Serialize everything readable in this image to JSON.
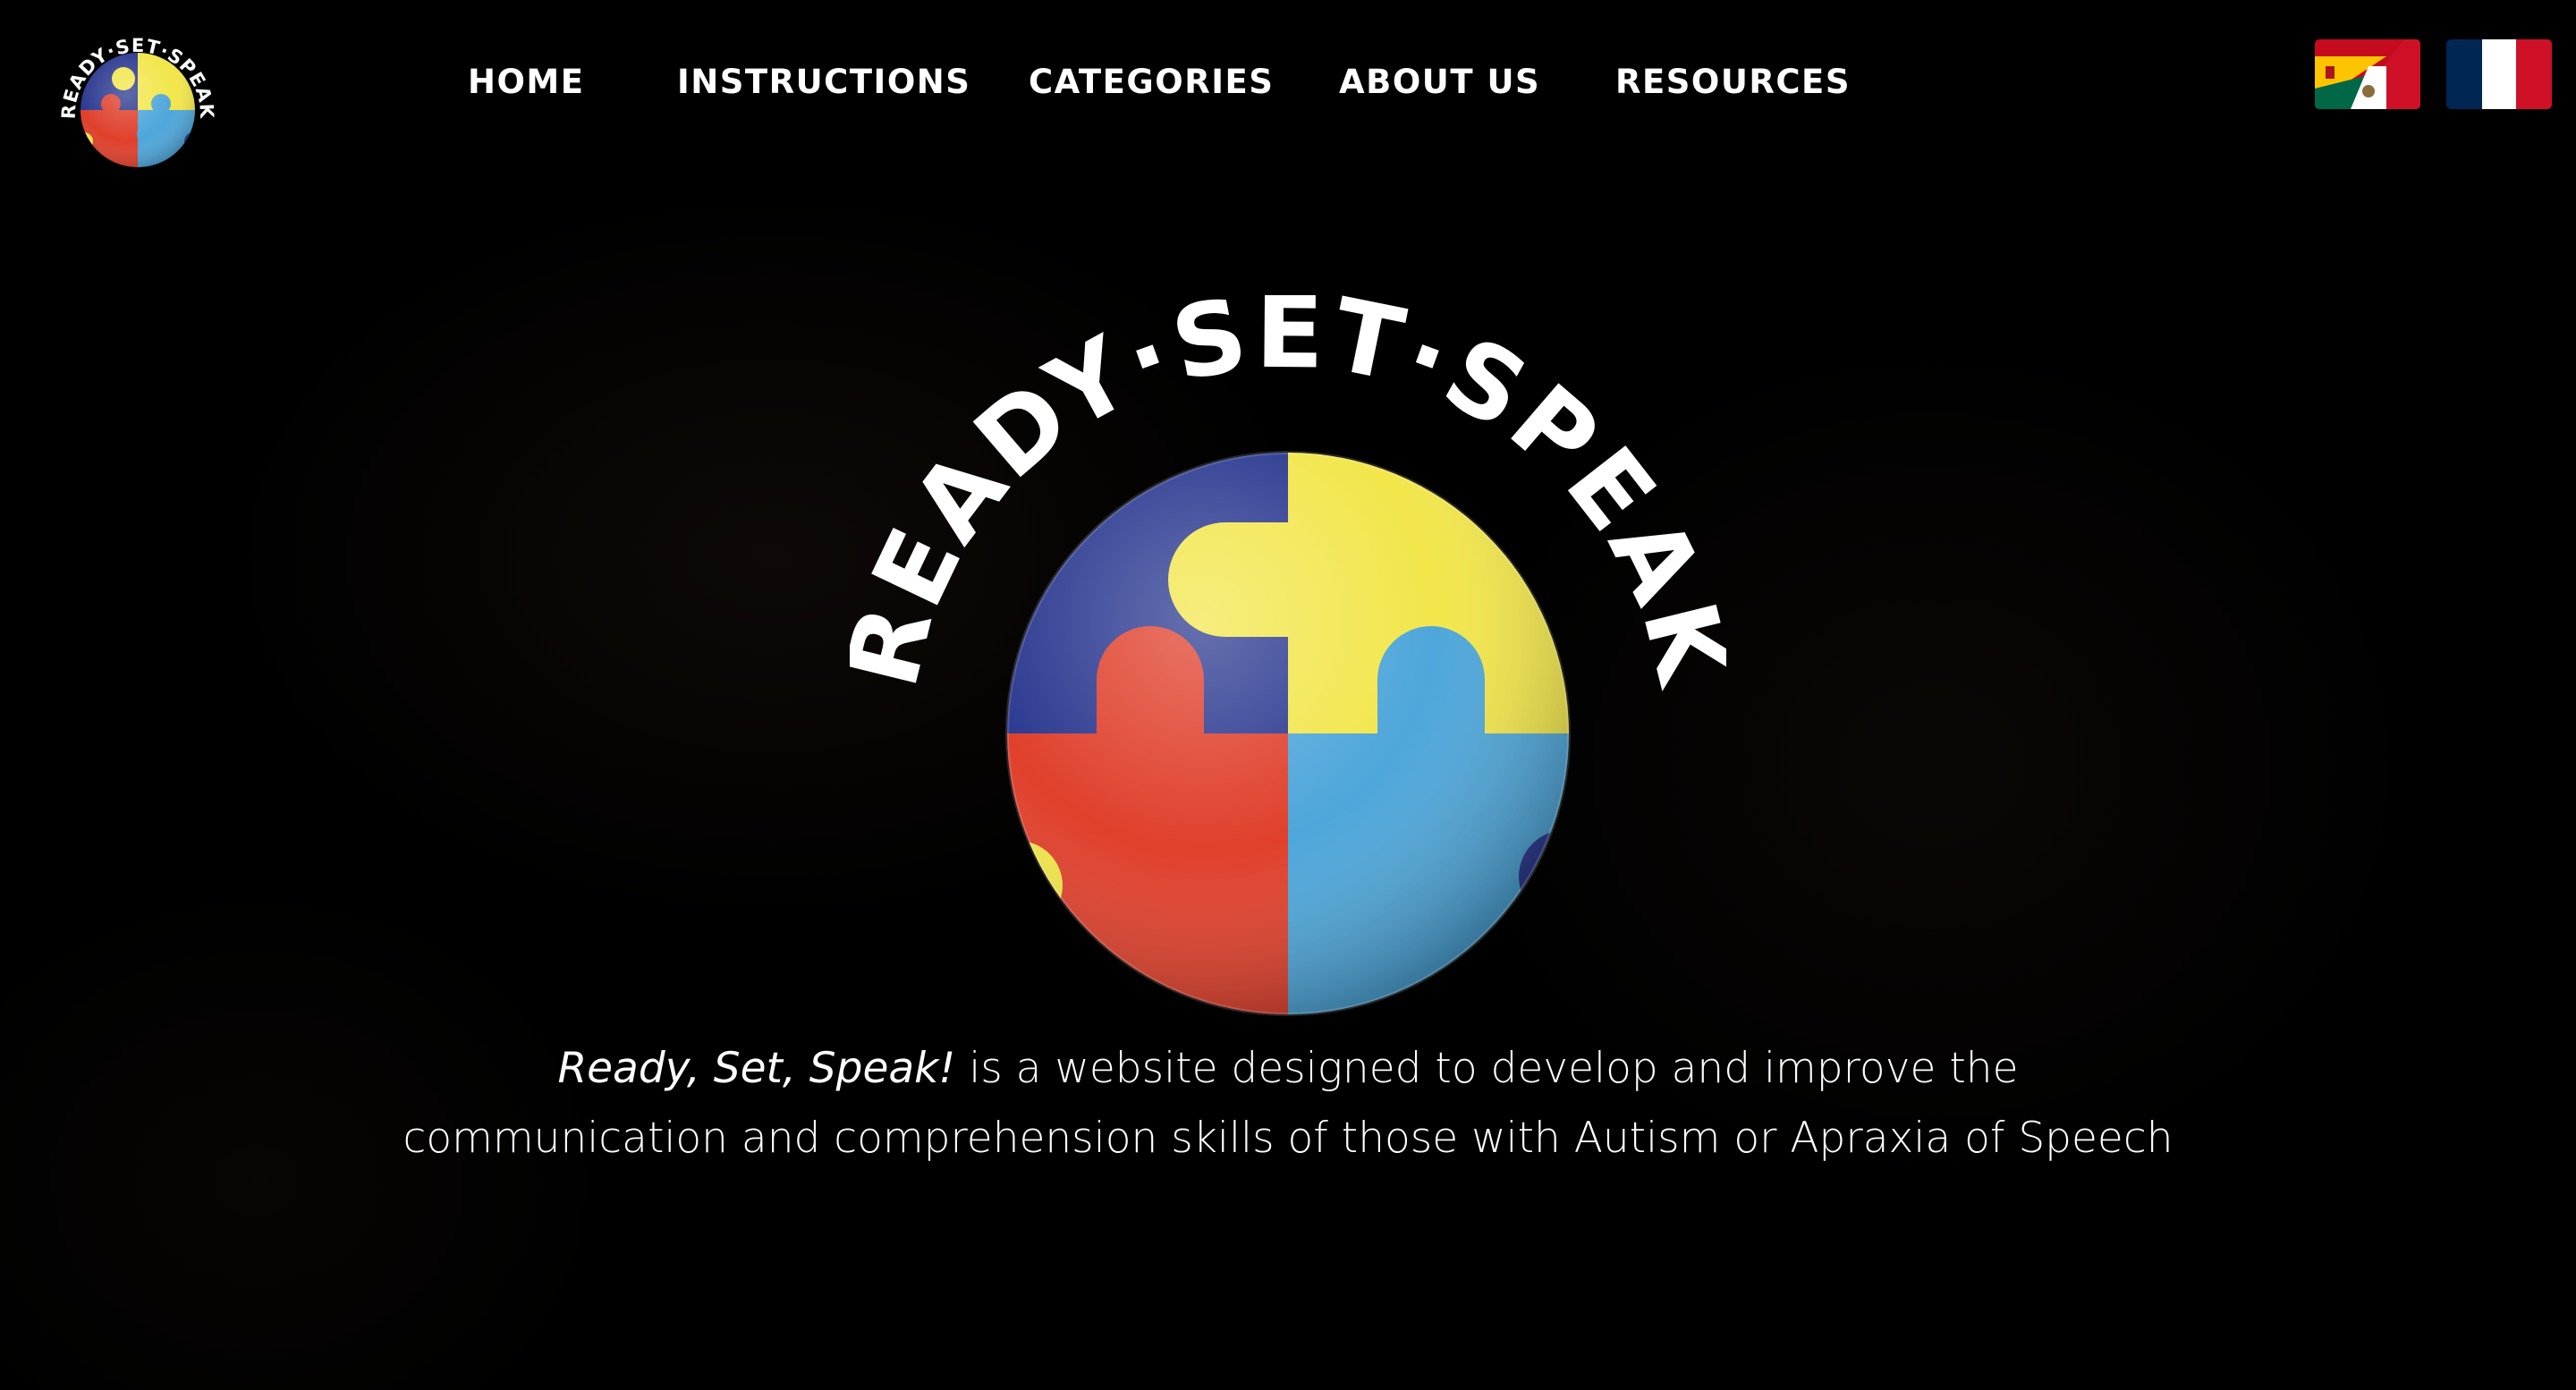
{
  "nav": {
    "items": [
      {
        "label": "HOME"
      },
      {
        "label": "INSTRUCTIONS"
      },
      {
        "label": "CATEGORIES"
      },
      {
        "label": "ABOUT US"
      },
      {
        "label": "RESOURCES"
      }
    ]
  },
  "logo": {
    "arc_text": "READY·SET·SPEAK"
  },
  "flags": [
    {
      "icon": "spain-mexico-flag-icon"
    },
    {
      "icon": "france-flag-icon"
    }
  ],
  "hero": {
    "tagline_italic": "Ready, Set, Speak!",
    "tagline_line1_rest": " is a website designed to develop and improve the",
    "tagline_line2": "communication and comprehension skills of those with Autism or Apraxia of Speech"
  },
  "colors": {
    "background": "#000000",
    "puzzle_blue": "#2b3990",
    "puzzle_yellow": "#f2e64b",
    "puzzle_red": "#e0402c",
    "puzzle_light_blue": "#4ea6da"
  }
}
